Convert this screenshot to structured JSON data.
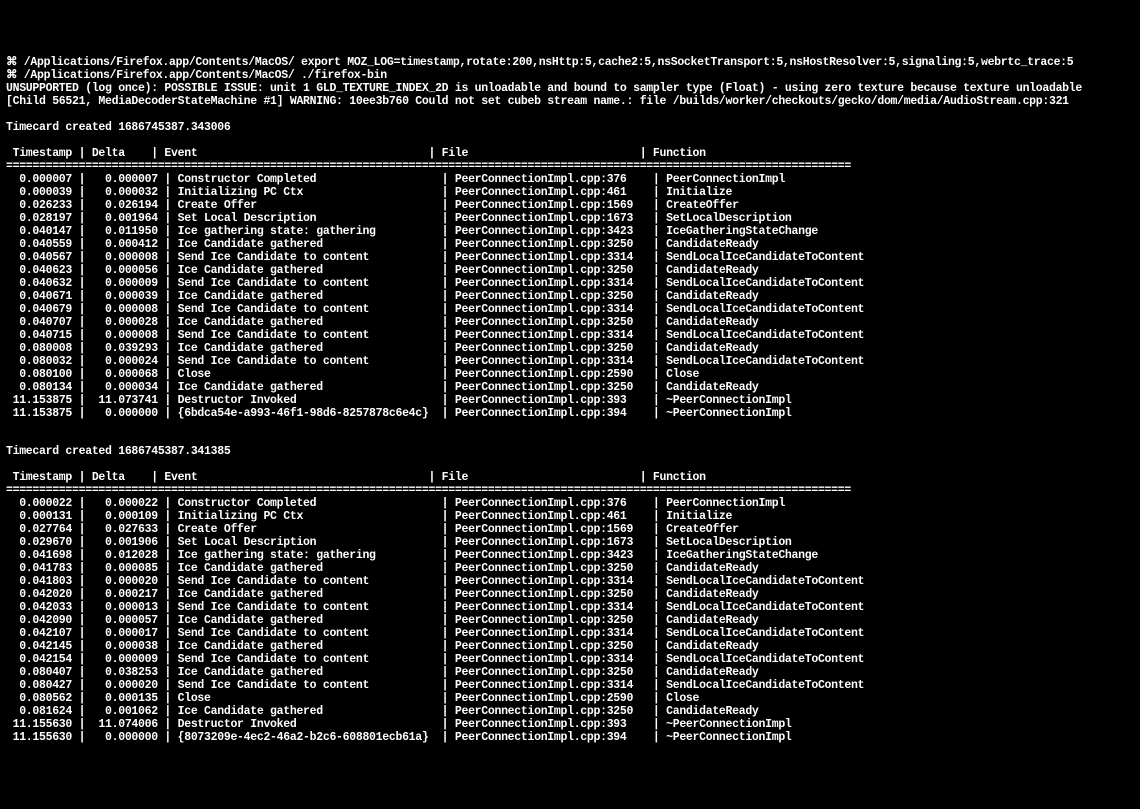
{
  "prompt_glyph": "⌘",
  "prompt_path": "/Applications/Firefox.app/Contents/MacOS/",
  "cmd1": "export MOZ_LOG=timestamp,rotate:200,nsHttp:5,cache2:5,nsSocketTransport:5,nsHostResolver:5,signaling:5,webrtc_trace:5",
  "cmd2": "./firefox-bin",
  "warn1": "UNSUPPORTED (log once): POSSIBLE ISSUE: unit 1 GLD_TEXTURE_INDEX_2D is unloadable and bound to sampler type (Float) - using zero texture because texture unloadable",
  "warn2": "[Child 56521, MediaDecoderStateMachine #1] WARNING: 10ee3b760 Could not set cubeb stream name.: file /builds/worker/checkouts/gecko/dom/media/AudioStream.cpp:321",
  "timecard1_title": "Timecard created 1686745387.343006",
  "timecard2_title": "Timecard created 1686745387.341385",
  "headers": {
    "ts": " Timestamp",
    "delta": "Delta",
    "event": "Event",
    "file": "File",
    "function": "Function"
  },
  "rows1": [
    {
      "ts": "0.000007",
      "delta": "0.000007",
      "event": "Constructor Completed",
      "file": "PeerConnectionImpl.cpp:376",
      "fn": "PeerConnectionImpl"
    },
    {
      "ts": "0.000039",
      "delta": "0.000032",
      "event": "Initializing PC Ctx",
      "file": "PeerConnectionImpl.cpp:461",
      "fn": "Initialize"
    },
    {
      "ts": "0.026233",
      "delta": "0.026194",
      "event": "Create Offer",
      "file": "PeerConnectionImpl.cpp:1569",
      "fn": "CreateOffer"
    },
    {
      "ts": "0.028197",
      "delta": "0.001964",
      "event": "Set Local Description",
      "file": "PeerConnectionImpl.cpp:1673",
      "fn": "SetLocalDescription"
    },
    {
      "ts": "0.040147",
      "delta": "0.011950",
      "event": "Ice gathering state: gathering",
      "file": "PeerConnectionImpl.cpp:3423",
      "fn": "IceGatheringStateChange"
    },
    {
      "ts": "0.040559",
      "delta": "0.000412",
      "event": "Ice Candidate gathered",
      "file": "PeerConnectionImpl.cpp:3250",
      "fn": "CandidateReady"
    },
    {
      "ts": "0.040567",
      "delta": "0.000008",
      "event": "Send Ice Candidate to content",
      "file": "PeerConnectionImpl.cpp:3314",
      "fn": "SendLocalIceCandidateToContent"
    },
    {
      "ts": "0.040623",
      "delta": "0.000056",
      "event": "Ice Candidate gathered",
      "file": "PeerConnectionImpl.cpp:3250",
      "fn": "CandidateReady"
    },
    {
      "ts": "0.040632",
      "delta": "0.000009",
      "event": "Send Ice Candidate to content",
      "file": "PeerConnectionImpl.cpp:3314",
      "fn": "SendLocalIceCandidateToContent"
    },
    {
      "ts": "0.040671",
      "delta": "0.000039",
      "event": "Ice Candidate gathered",
      "file": "PeerConnectionImpl.cpp:3250",
      "fn": "CandidateReady"
    },
    {
      "ts": "0.040679",
      "delta": "0.000008",
      "event": "Send Ice Candidate to content",
      "file": "PeerConnectionImpl.cpp:3314",
      "fn": "SendLocalIceCandidateToContent"
    },
    {
      "ts": "0.040707",
      "delta": "0.000028",
      "event": "Ice Candidate gathered",
      "file": "PeerConnectionImpl.cpp:3250",
      "fn": "CandidateReady"
    },
    {
      "ts": "0.040715",
      "delta": "0.000008",
      "event": "Send Ice Candidate to content",
      "file": "PeerConnectionImpl.cpp:3314",
      "fn": "SendLocalIceCandidateToContent"
    },
    {
      "ts": "0.080008",
      "delta": "0.039293",
      "event": "Ice Candidate gathered",
      "file": "PeerConnectionImpl.cpp:3250",
      "fn": "CandidateReady"
    },
    {
      "ts": "0.080032",
      "delta": "0.000024",
      "event": "Send Ice Candidate to content",
      "file": "PeerConnectionImpl.cpp:3314",
      "fn": "SendLocalIceCandidateToContent"
    },
    {
      "ts": "0.080100",
      "delta": "0.000068",
      "event": "Close",
      "file": "PeerConnectionImpl.cpp:2590",
      "fn": "Close"
    },
    {
      "ts": "0.080134",
      "delta": "0.000034",
      "event": "Ice Candidate gathered",
      "file": "PeerConnectionImpl.cpp:3250",
      "fn": "CandidateReady"
    },
    {
      "ts": "11.153875",
      "delta": "11.073741",
      "event": "Destructor Invoked",
      "file": "PeerConnectionImpl.cpp:393",
      "fn": "~PeerConnectionImpl"
    },
    {
      "ts": "11.153875",
      "delta": "0.000000",
      "event": "{6bdca54e-a993-46f1-98d6-8257878c6e4c}",
      "file": "PeerConnectionImpl.cpp:394",
      "fn": "~PeerConnectionImpl"
    }
  ],
  "rows2": [
    {
      "ts": "0.000022",
      "delta": "0.000022",
      "event": "Constructor Completed",
      "file": "PeerConnectionImpl.cpp:376",
      "fn": "PeerConnectionImpl"
    },
    {
      "ts": "0.000131",
      "delta": "0.000109",
      "event": "Initializing PC Ctx",
      "file": "PeerConnectionImpl.cpp:461",
      "fn": "Initialize"
    },
    {
      "ts": "0.027764",
      "delta": "0.027633",
      "event": "Create Offer",
      "file": "PeerConnectionImpl.cpp:1569",
      "fn": "CreateOffer"
    },
    {
      "ts": "0.029670",
      "delta": "0.001906",
      "event": "Set Local Description",
      "file": "PeerConnectionImpl.cpp:1673",
      "fn": "SetLocalDescription"
    },
    {
      "ts": "0.041698",
      "delta": "0.012028",
      "event": "Ice gathering state: gathering",
      "file": "PeerConnectionImpl.cpp:3423",
      "fn": "IceGatheringStateChange"
    },
    {
      "ts": "0.041783",
      "delta": "0.000085",
      "event": "Ice Candidate gathered",
      "file": "PeerConnectionImpl.cpp:3250",
      "fn": "CandidateReady"
    },
    {
      "ts": "0.041803",
      "delta": "0.000020",
      "event": "Send Ice Candidate to content",
      "file": "PeerConnectionImpl.cpp:3314",
      "fn": "SendLocalIceCandidateToContent"
    },
    {
      "ts": "0.042020",
      "delta": "0.000217",
      "event": "Ice Candidate gathered",
      "file": "PeerConnectionImpl.cpp:3250",
      "fn": "CandidateReady"
    },
    {
      "ts": "0.042033",
      "delta": "0.000013",
      "event": "Send Ice Candidate to content",
      "file": "PeerConnectionImpl.cpp:3314",
      "fn": "SendLocalIceCandidateToContent"
    },
    {
      "ts": "0.042090",
      "delta": "0.000057",
      "event": "Ice Candidate gathered",
      "file": "PeerConnectionImpl.cpp:3250",
      "fn": "CandidateReady"
    },
    {
      "ts": "0.042107",
      "delta": "0.000017",
      "event": "Send Ice Candidate to content",
      "file": "PeerConnectionImpl.cpp:3314",
      "fn": "SendLocalIceCandidateToContent"
    },
    {
      "ts": "0.042145",
      "delta": "0.000038",
      "event": "Ice Candidate gathered",
      "file": "PeerConnectionImpl.cpp:3250",
      "fn": "CandidateReady"
    },
    {
      "ts": "0.042154",
      "delta": "0.000009",
      "event": "Send Ice Candidate to content",
      "file": "PeerConnectionImpl.cpp:3314",
      "fn": "SendLocalIceCandidateToContent"
    },
    {
      "ts": "0.080407",
      "delta": "0.038253",
      "event": "Ice Candidate gathered",
      "file": "PeerConnectionImpl.cpp:3250",
      "fn": "CandidateReady"
    },
    {
      "ts": "0.080427",
      "delta": "0.000020",
      "event": "Send Ice Candidate to content",
      "file": "PeerConnectionImpl.cpp:3314",
      "fn": "SendLocalIceCandidateToContent"
    },
    {
      "ts": "0.080562",
      "delta": "0.000135",
      "event": "Close",
      "file": "PeerConnectionImpl.cpp:2590",
      "fn": "Close"
    },
    {
      "ts": "0.081624",
      "delta": "0.001062",
      "event": "Ice Candidate gathered",
      "file": "PeerConnectionImpl.cpp:3250",
      "fn": "CandidateReady"
    },
    {
      "ts": "11.155630",
      "delta": "11.074006",
      "event": "Destructor Invoked",
      "file": "PeerConnectionImpl.cpp:393",
      "fn": "~PeerConnectionImpl"
    },
    {
      "ts": "11.155630",
      "delta": "0.000000",
      "event": "{8073209e-4ec2-46a2-b2c6-608801ecb61a}",
      "file": "PeerConnectionImpl.cpp:394",
      "fn": "~PeerConnectionImpl"
    }
  ]
}
